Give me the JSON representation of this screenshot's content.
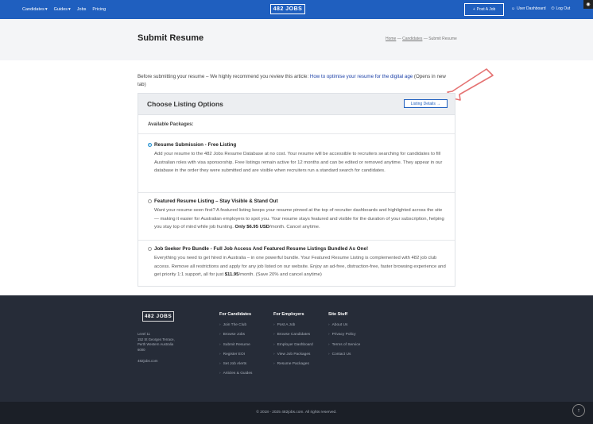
{
  "nav": {
    "items": [
      {
        "label": "Candidates",
        "caret": true
      },
      {
        "label": "Guides",
        "caret": true
      },
      {
        "label": "Jobs",
        "caret": false
      },
      {
        "label": "Pricing",
        "caret": false
      }
    ],
    "logo": "482 JOBS",
    "post_job": "Post A Job",
    "user_dashboard": "User Dashboard",
    "logout": "Log Out"
  },
  "header": {
    "title": "Submit Resume",
    "breadcrumb": {
      "home": "Home",
      "sep": "—",
      "section": "Candidates",
      "current": "Submit Resume"
    }
  },
  "intro": {
    "text_before": "Before submitting your resume – We highly recommend you review this article: ",
    "link": "How to optimise your resume for the digital age",
    "text_after": " (Opens in new tab)"
  },
  "listing": {
    "title": "Choose Listing Options",
    "details_button": "Listing Details →",
    "packages_label": "Available Packages:",
    "packages": [
      {
        "title": "Resume Submission - Free Listing",
        "selected": true,
        "desc": "Add your resume to the 482 Jobs Resume Database at no cost. Your resume will be accessible to recruiters searching for candidates to fill Australian roles with visa sponsorship. Free listings remain active for 12 months and can be edited or removed anytime. They appear in our database in the order they were submitted and are visible when recruiters run a standard search for candidates.",
        "price": "",
        "desc_after": ""
      },
      {
        "title": "Featured Resume Listing – Stay Visible & Stand Out",
        "selected": false,
        "desc": "Want your resume seen first? A featured listing keeps your resume pinned at the top of recruiter dashboards and highlighted across the site — making it easier for Australian employers to spot you. Your resume stays featured and visible for the duration of your subscription, helping you stay top of mind while job hunting. ",
        "price": "Only $6.95 USD",
        "desc_after": "/month. Cancel anytime."
      },
      {
        "title": "Job Seeker Pro Bundle - Full Job Access And Featured Resume Listings Bundled As One!",
        "selected": false,
        "desc": "Everything you need to get hired in Australia – in one powerful bundle. Your Featured Resume Listing is complemented with 482 job club access. Remove all restrictions and apply for any job listed on our website. Enjoy an ad-free, distraction-free, faster browsing experience and get priority 1:1 support, all for just ",
        "price": "$11.95",
        "desc_after": "/month. (Save 20% and cancel anytime)"
      }
    ]
  },
  "footer": {
    "logo": "482 JOBS",
    "address": [
      "Level 11",
      "152 St Georges Terrace,",
      "Perth Western Australia",
      "6000"
    ],
    "site": "482jobs.com",
    "columns": [
      {
        "title": "For Candidates",
        "items": [
          "Join The Club",
          "Browse Jobs",
          "Submit Resume",
          "Register EOI",
          "Set Job Alerts",
          "Articles & Guides"
        ]
      },
      {
        "title": "For Employers",
        "items": [
          "Post A Job",
          "Browse Candidates",
          "Employer Dashboard",
          "View Job Packages",
          "Resume Packages"
        ]
      },
      {
        "title": "Site Stuff",
        "items": [
          "About Us",
          "Privacy Policy",
          "Terms of Service",
          "Contact Us"
        ]
      }
    ],
    "copyright": "© 2018 - 2025 482jobs.com. All rights reserved."
  },
  "icons": {
    "arrow_item": "›",
    "to_top": "↑"
  },
  "colors": {
    "brand": "#1f5fbf",
    "footer": "#262c38",
    "annotation": "#e57373"
  }
}
